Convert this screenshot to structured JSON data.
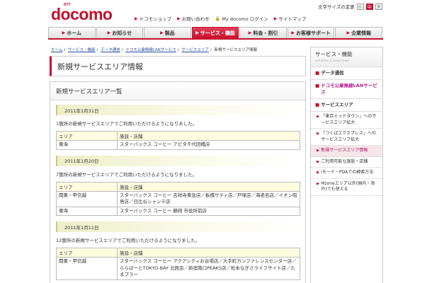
{
  "header": {
    "logo_ntt": "NTT",
    "logo_word": "docomo",
    "font_size_label": "文字サイズの変更",
    "font_size_buttons": [
      "小",
      "中",
      "大"
    ],
    "util_links": [
      "ドコモショップ",
      "お問い合わせ",
      "My docomo ログイン",
      "サイトマップ"
    ]
  },
  "nav": {
    "tabs": [
      "ホーム",
      "お知らせ",
      "製品",
      "サービス・機能",
      "料金・割引",
      "お客様サポート",
      "企業情報"
    ]
  },
  "breadcrumb": [
    "ホーム",
    "サービス・機能",
    "データ通信",
    "ドコモ公衆無線LANサービス",
    "サービスエリア",
    "新規サービスエリア情報"
  ],
  "page_title": "新規サービスエリア情報",
  "content_title": "新規サービスエリア一覧",
  "table_headers": {
    "area": "エリア",
    "shops": "施設・店舗"
  },
  "sections": [
    {
      "date": "2011年1月31日",
      "note": "1箇所の新規サービスエリアでご利用いただけるようになりました。",
      "rows": [
        {
          "area": "東海",
          "shops": "スターバックス コーヒー アピタ千代田橋店"
        }
      ]
    },
    {
      "date": "2011年1月20日",
      "note": "7箇所の新規サービスエリアでご利用いただけるようになりました。",
      "rows": [
        {
          "area": "関東・甲信越",
          "shops": "スターバックス コーヒー 吉祥寺東急店／板橋サティ店／戸塚店／海老名店／イオン昭島店／日比谷シャンテ店"
        },
        {
          "area": "東海",
          "shops": "スターバックス コーヒー 静岡 市役所前店"
        }
      ]
    },
    {
      "date": "2011年1月11日",
      "note": "12箇所の新規サービスエリアでご利用いただけるようになりました。",
      "rows": [
        {
          "area": "関東・甲信越",
          "shops": "スターバックス コーヒー アクアシティお台場店／大手町カンファレンスセンター店／ららぽーとTOKYO-BAY 北館店／新宿南口PEAKS店／松本なぎさライフサイト店／たまプラー"
        }
      ]
    }
  ],
  "sidebar": {
    "title": "サービス・機能",
    "subtitle": "SERVICES & FUNCTIONS",
    "categories": [
      {
        "label": "データ通信",
        "pink": false
      },
      {
        "label": "ドコモ公衆無線LANサービス",
        "pink": true
      },
      {
        "label": "サービスエリア",
        "pink": false
      }
    ],
    "subitems": [
      "「東京ミッドタウン」へのサービスエリア拡大",
      "「つくばエクスプレス」へのサービスエリア拡大",
      "新規サービスエリア情報",
      "ご利用可能な施設・店舗",
      "iモード・PDAでの検索方法",
      "Mzoneエリア以外(国内・海外)でも使える"
    ]
  },
  "colors": {
    "brand": "#c8102e",
    "link": "#2a4f9e",
    "date_bar": "#eeeec8"
  }
}
